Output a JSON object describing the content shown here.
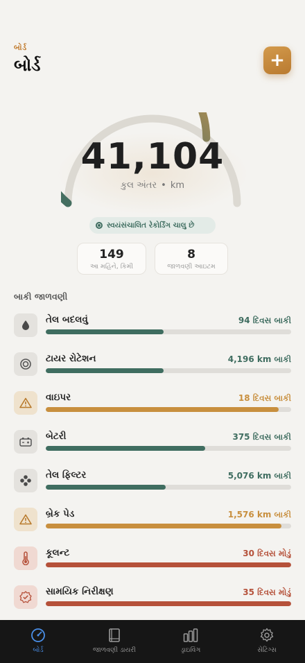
{
  "header": {
    "eyebrow": "બોર્ડ",
    "title": "બોર્ડ",
    "add_label": "+"
  },
  "odometer": {
    "value": "41,104",
    "label": "કુલ અંતર",
    "separator": "•",
    "unit": "km",
    "progress": 0.72
  },
  "auto_recording": "સ્વયંસંચાલિત રેકોર્ડિંગ ચાલુ છે",
  "stats": [
    {
      "value": "149",
      "label": "આ મહિને, કિમી"
    },
    {
      "value": "8",
      "label": "જાળવણી આઇટમ"
    }
  ],
  "section_title": "બાકી જાળવણી",
  "items": [
    {
      "name": "તેલ બદલવું",
      "status": "94 દિવસ બાકી",
      "progress": 0.48,
      "color": "#3f6d60",
      "icon": "oil-drop-icon"
    },
    {
      "name": "ટાયર રોટેશન",
      "status": "4,196 km બાકી",
      "progress": 0.48,
      "color": "#3f6d60",
      "icon": "tire-icon"
    },
    {
      "name": "વાઇપર",
      "status": "18 દિવસ બાકી",
      "progress": 0.95,
      "color": "#c88f3e",
      "icon": "warning-icon"
    },
    {
      "name": "બેટરી",
      "status": "375 દિવસ બાકી",
      "progress": 0.65,
      "color": "#3f6d60",
      "icon": "battery-icon"
    },
    {
      "name": "તેલ ફિલ્ટર",
      "status": "5,076 km બાકી",
      "progress": 0.49,
      "color": "#3f6d60",
      "icon": "filter-icon"
    },
    {
      "name": "બ્રેક પેડ",
      "status": "1,576 km બાકી",
      "progress": 0.96,
      "color": "#c88f3e",
      "icon": "warning-icon"
    },
    {
      "name": "કૂલન્ટ",
      "status": "30 દિવસ મોડું",
      "progress": 1.0,
      "color": "#b5513a",
      "icon": "thermometer-icon"
    },
    {
      "name": "સામયિક નિરીક્ષણ",
      "status": "35 દિવસ મોડું",
      "progress": 1.0,
      "color": "#b5513a",
      "icon": "badge-check-icon"
    }
  ],
  "tabs": [
    {
      "label": "બોર્ડ",
      "icon": "gauge-icon",
      "active": true
    },
    {
      "label": "જાળવણી ડાયરી",
      "icon": "book-icon",
      "active": false
    },
    {
      "label": "ડ્રાઇવિંગ",
      "icon": "bar-chart-icon",
      "active": false
    },
    {
      "label": "સેટિંગ્સ",
      "icon": "gear-icon",
      "active": false
    }
  ],
  "colors": {
    "accent": "#c88f3e",
    "green": "#3f6d60",
    "overdue": "#b5513a",
    "tab_active": "#4a8fe8"
  }
}
